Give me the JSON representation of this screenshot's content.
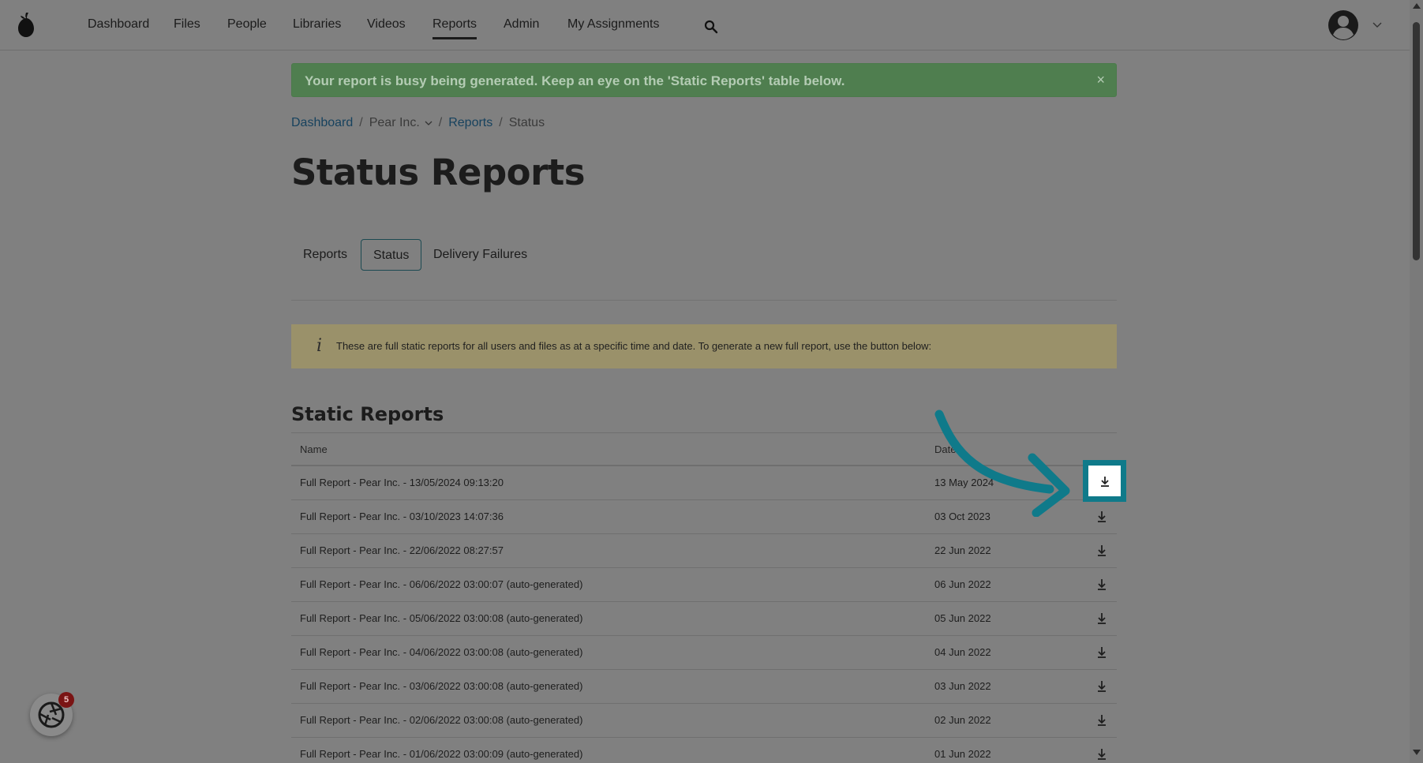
{
  "nav": {
    "items": [
      {
        "label": "Dashboard"
      },
      {
        "label": "Files"
      },
      {
        "label": "People"
      },
      {
        "label": "Libraries"
      },
      {
        "label": "Videos"
      },
      {
        "label": "Reports",
        "active": true
      },
      {
        "label": "Admin"
      },
      {
        "label": "My Assignments"
      }
    ]
  },
  "alert": {
    "message": "Your report is busy being generated. Keep an eye on the 'Static Reports' table below.",
    "close": "×"
  },
  "breadcrumb": {
    "dashboard": "Dashboard",
    "sep1": "/",
    "org": "Pear Inc.",
    "sep2": "/",
    "reports": "Reports",
    "sep3": "/",
    "current": "Status"
  },
  "page": {
    "title": "Status Reports"
  },
  "tabs": [
    {
      "label": "Reports"
    },
    {
      "label": "Status",
      "active": true
    },
    {
      "label": "Delivery Failures"
    }
  ],
  "info": {
    "icon": "i",
    "text": "These are full static reports for all users and files as at a specific time and date. To generate a new full report, use the button below:"
  },
  "static_reports": {
    "title": "Static Reports",
    "columns": {
      "name": "Name",
      "date": "Date"
    },
    "rows": [
      {
        "name": "Full Report - Pear Inc. - 13/05/2024 09:13:20",
        "date": "13 May 2024"
      },
      {
        "name": "Full Report - Pear Inc. - 03/10/2023 14:07:36",
        "date": "03 Oct 2023"
      },
      {
        "name": "Full Report - Pear Inc. - 22/06/2022 08:27:57",
        "date": "22 Jun 2022"
      },
      {
        "name": "Full Report - Pear Inc. - 06/06/2022 03:00:07 (auto-generated)",
        "date": "06 Jun 2022"
      },
      {
        "name": "Full Report - Pear Inc. - 05/06/2022 03:00:08 (auto-generated)",
        "date": "05 Jun 2022"
      },
      {
        "name": "Full Report - Pear Inc. - 04/06/2022 03:00:08 (auto-generated)",
        "date": "04 Jun 2022"
      },
      {
        "name": "Full Report - Pear Inc. - 03/06/2022 03:00:08 (auto-generated)",
        "date": "03 Jun 2022"
      },
      {
        "name": "Full Report - Pear Inc. - 02/06/2022 03:00:08 (auto-generated)",
        "date": "02 Jun 2022"
      },
      {
        "name": "Full Report - Pear Inc. - 01/06/2022 03:00:09 (auto-generated)",
        "date": "01 Jun 2022"
      }
    ]
  },
  "widget": {
    "badge": "5"
  },
  "colors": {
    "highlight": "#0f7a8a",
    "alert_bg": "#4f7e4f",
    "info_bg": "#9a916a",
    "link": "#17425e"
  }
}
